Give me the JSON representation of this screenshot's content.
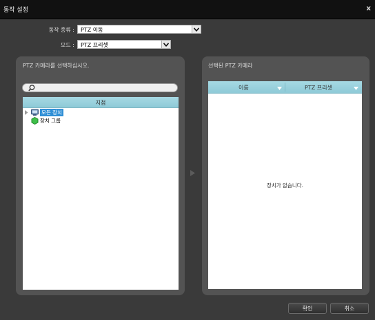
{
  "window": {
    "title": "동작 설정",
    "close_glyph": "x"
  },
  "form": {
    "action_type_label": "동작 종류 :",
    "action_type_value": "PTZ 이동",
    "mode_label": "모드 :",
    "mode_value": "PTZ 프리셋"
  },
  "left_panel": {
    "title": "PTZ 카메라를 선택하십시오.",
    "search_placeholder": "",
    "tree_header": "지점",
    "nodes": [
      {
        "label": "모든 장치",
        "selected": true,
        "icon": "device-group-icon"
      },
      {
        "label": "장치 그룹",
        "selected": false,
        "icon": "green-hexagon-icon"
      }
    ]
  },
  "right_panel": {
    "title": "선택된 PTZ 카메라",
    "columns": [
      "이름",
      "PTZ 프리셋"
    ],
    "empty_text": "장치가 없습니다."
  },
  "buttons": {
    "ok": "확인",
    "cancel": "취소"
  },
  "colors": {
    "accent_header": "#9fd4df",
    "selection": "#2f8fd6",
    "panel": "#535353",
    "titlebar": "#111111"
  }
}
